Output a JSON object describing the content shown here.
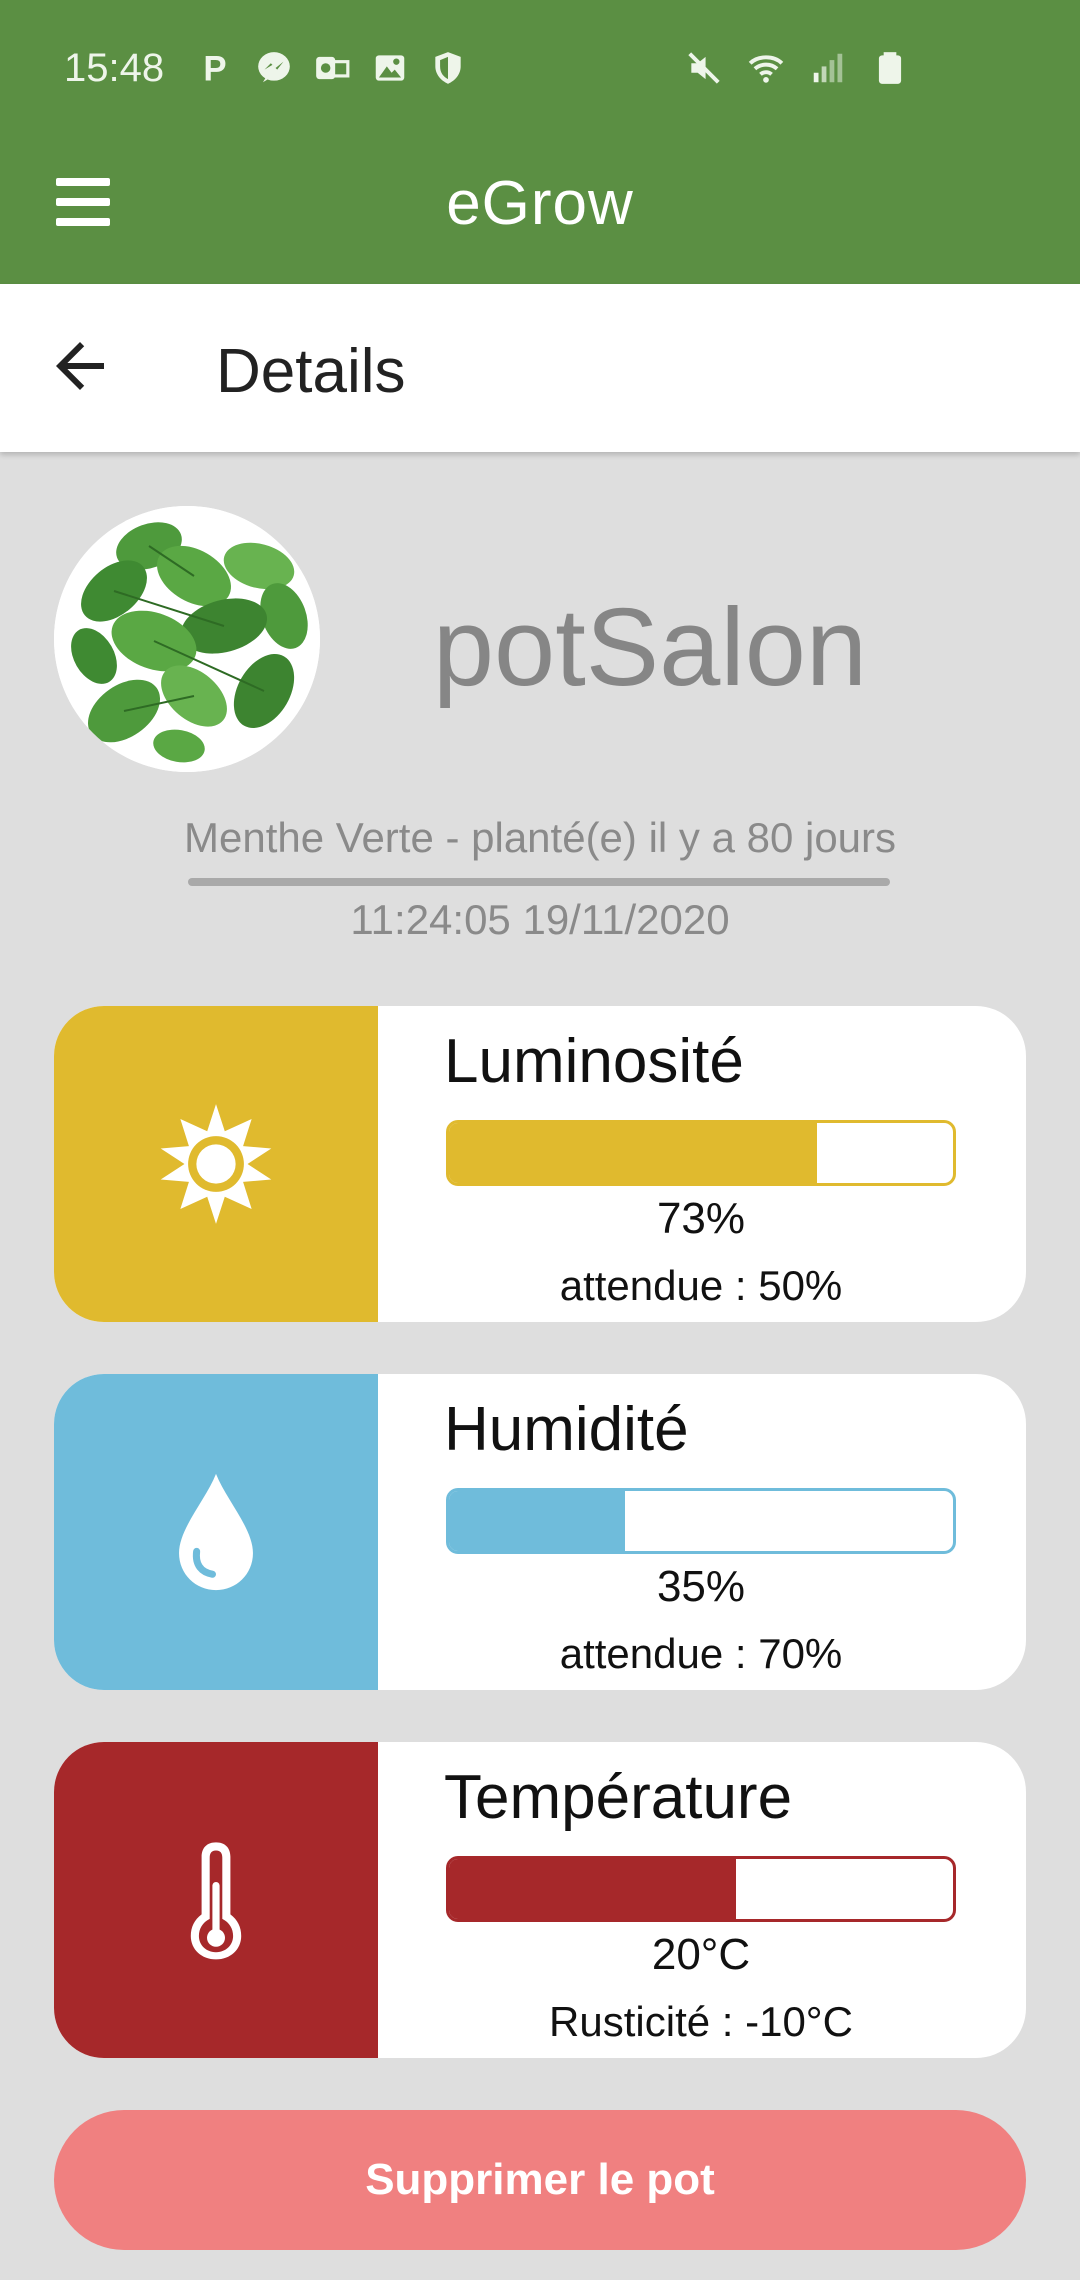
{
  "status_bar": {
    "time": "15:48",
    "left_icons": [
      "p-icon",
      "messenger-icon",
      "outlook-icon",
      "gallery-icon",
      "shield-icon"
    ],
    "right_icons": [
      "mute-icon",
      "wifi-icon",
      "signal-icon",
      "battery-icon"
    ]
  },
  "toolbar": {
    "title": "eGrow",
    "menu_icon": "hamburger-menu-icon",
    "color": "#5b8f43"
  },
  "subheader": {
    "title": "Details",
    "back_icon": "back-arrow-icon"
  },
  "plant": {
    "name": "potSalon",
    "description": "Menthe Verte - planté(e) il y a 80 jours",
    "timestamp": "11:24:05 19/11/2020"
  },
  "sensors": [
    {
      "title": "Luminosité",
      "icon": "sun-icon",
      "color": "#e0ba2e",
      "level": 0.73,
      "value": "73%",
      "expected": "attendue : 50%"
    },
    {
      "title": "Humidité",
      "icon": "water-drop-icon",
      "color": "#6fbcdb",
      "level": 0.35,
      "value": "35%",
      "expected": "attendue : 70%"
    },
    {
      "title": "Température",
      "icon": "thermometer-icon",
      "color": "#a6282a",
      "level": 0.57,
      "value": "20°C",
      "expected": "Rusticité : -10°C"
    }
  ],
  "actions": {
    "delete_label": "Supprimer le pot",
    "delete_color": "#f08080"
  }
}
